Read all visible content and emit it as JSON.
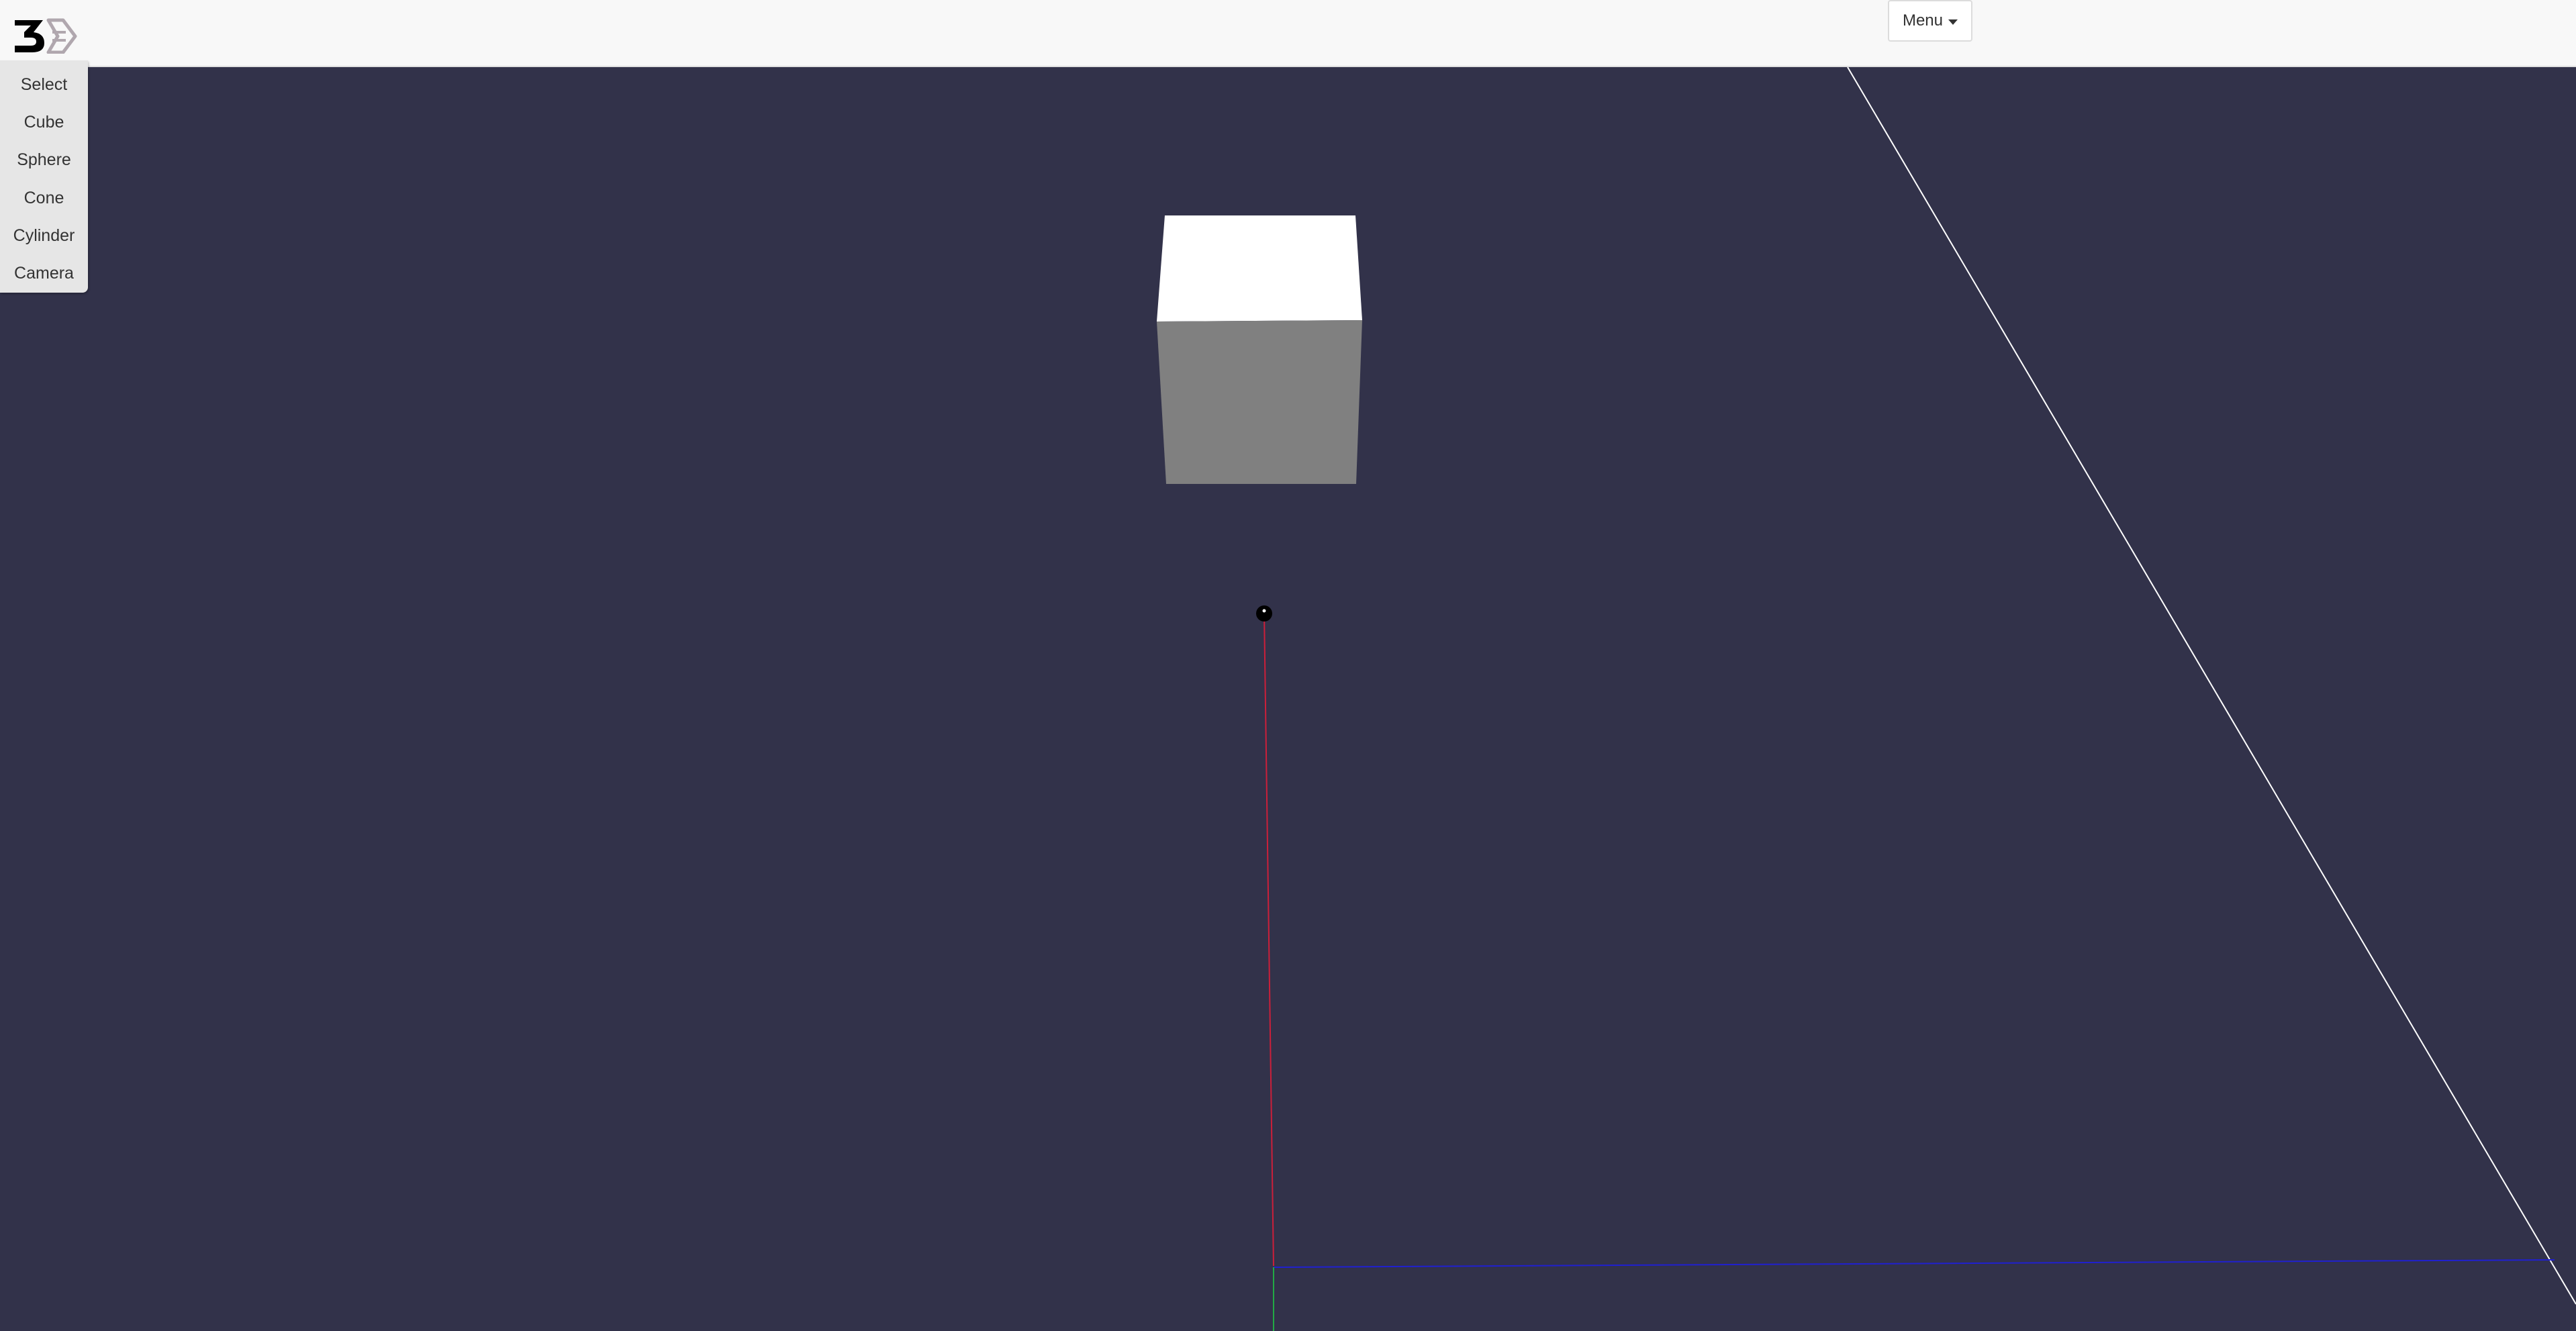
{
  "navbar": {
    "menu_label": "Menu"
  },
  "toolbar": {
    "items": [
      {
        "label": "Select"
      },
      {
        "label": "Cube"
      },
      {
        "label": "Sphere"
      },
      {
        "label": "Cone"
      },
      {
        "label": "Cylinder"
      },
      {
        "label": "Camera"
      }
    ]
  },
  "scene": {
    "background_color": "#32324a",
    "cube_top_color": "#ffffff",
    "cube_front_color": "#808080",
    "axis_x_color": "#cc1f3a",
    "axis_y_color": "#22aa44",
    "axis_z_color": "#2020d0",
    "grid_line_color": "#ffffff"
  }
}
